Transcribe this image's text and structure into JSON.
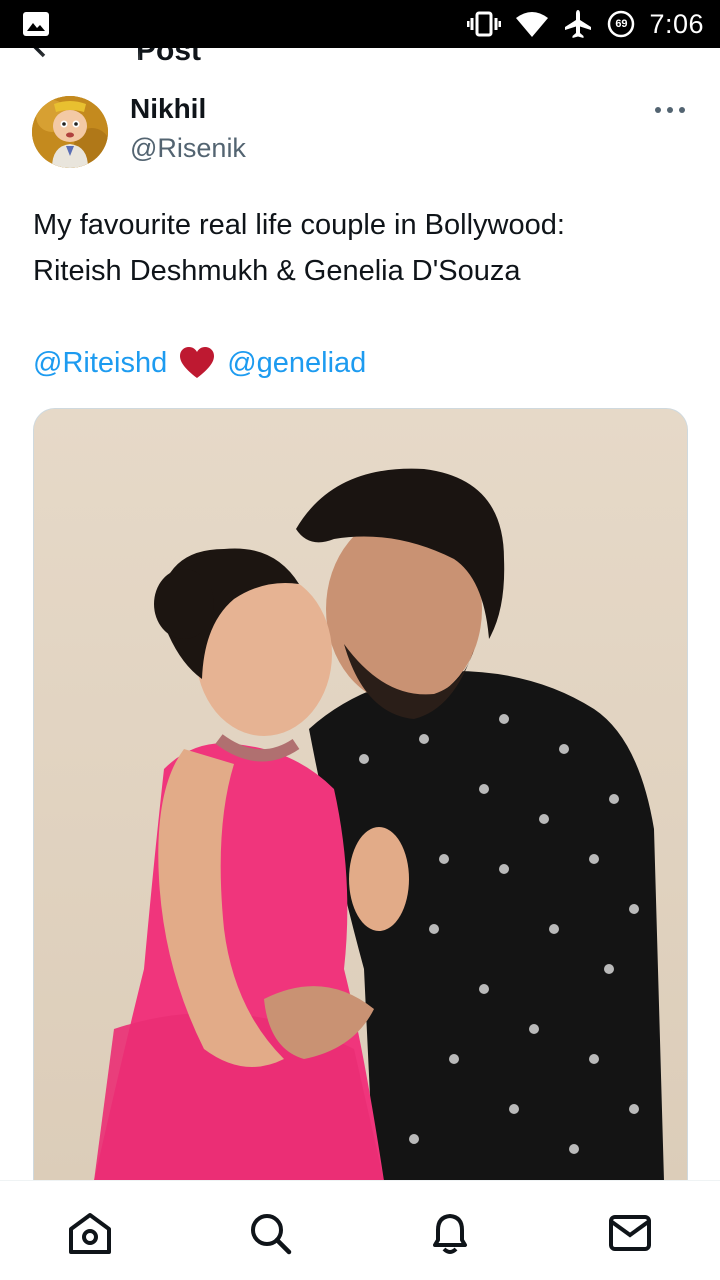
{
  "status_bar": {
    "time": "7:06",
    "battery_level": "69",
    "icons": [
      "image-icon",
      "vibrate-icon",
      "wifi-icon",
      "airplane-icon",
      "battery-icon"
    ]
  },
  "header": {
    "title": "Post",
    "back_icon": "back-arrow-icon"
  },
  "post": {
    "author": {
      "name": "Nikhil",
      "handle": "@Risenik"
    },
    "more_icon": "more-dots-icon",
    "text_lines": [
      "My favourite real life couple in Bollywood:",
      "Riteish Deshmukh & Genelia D'Souza"
    ],
    "mentions": [
      "@Riteishd",
      "@geneliad"
    ],
    "mention_separator_icon": "red-heart-icon",
    "mention_color": "#1d9bf0"
  },
  "bottom_nav": {
    "items": [
      "home-icon",
      "search-icon",
      "notifications-icon",
      "messages-icon"
    ]
  }
}
